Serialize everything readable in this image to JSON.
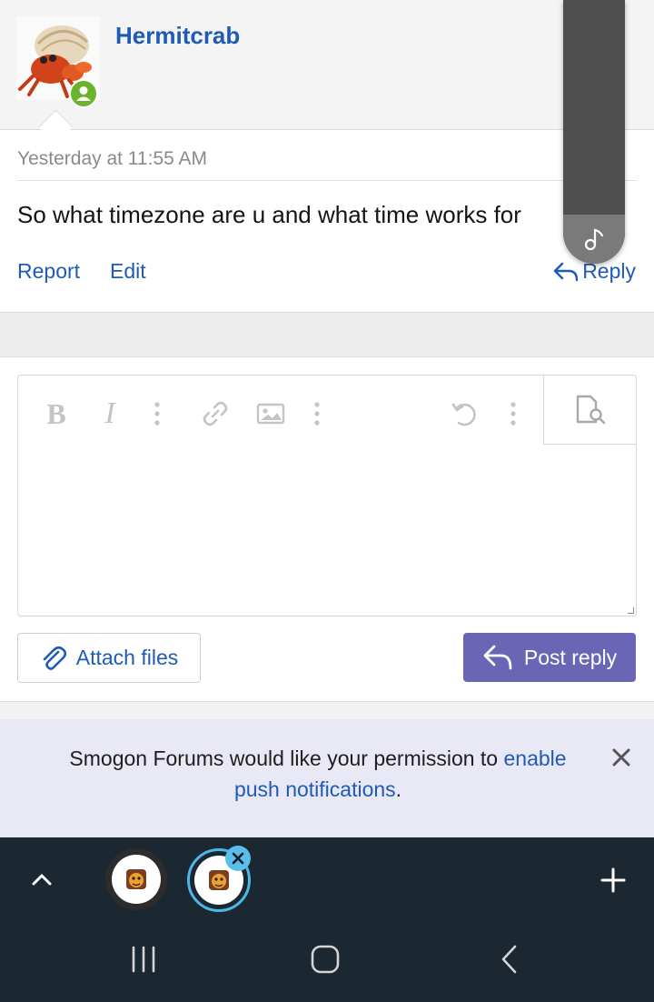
{
  "post": {
    "username": "Hermitcrab",
    "timestamp": "Yesterday at 11:55 AM",
    "message": "So what timezone are u and what time works for",
    "actions": {
      "report": "Report",
      "edit": "Edit",
      "reply": "Reply"
    }
  },
  "editor": {
    "toolbar_icons": [
      "bold-icon",
      "italic-icon",
      "more-vertical-icon",
      "link-icon",
      "image-icon",
      "more-vertical-icon",
      "undo-icon",
      "more-vertical-icon",
      "preview-icon"
    ],
    "attach_label": "Attach files",
    "post_label": "Post reply"
  },
  "push_notice": {
    "text_before": "Smogon Forums would like your permission to ",
    "link_text": "enable push notifications",
    "text_after": "."
  },
  "colors": {
    "link": "#1f5bb5",
    "primary_button": "#6a66b5",
    "online": "#6cb22c",
    "browser_bar": "#1b2731",
    "active_tab_ring": "#4cb8e8"
  }
}
